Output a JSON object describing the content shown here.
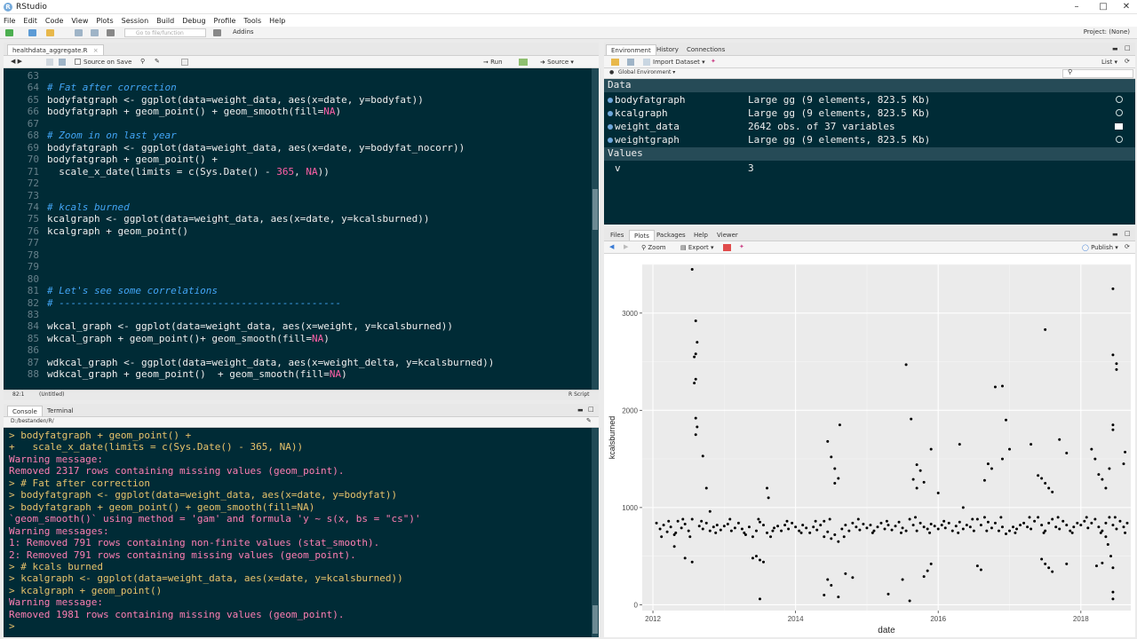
{
  "app": {
    "title": "RStudio"
  },
  "menu": [
    "File",
    "Edit",
    "Code",
    "View",
    "Plots",
    "Session",
    "Build",
    "Debug",
    "Profile",
    "Tools",
    "Help"
  ],
  "toolbar": {
    "goto_placeholder": "Go to file/function",
    "addins": "Addins",
    "project": "Project: (None)"
  },
  "editor": {
    "tab": "healthdata_aggregate.R",
    "source_on_save": "Source on Save",
    "run": "Run",
    "source": "Source",
    "status_left": "82:1",
    "status_scope": "(Untitled)",
    "status_right": "R Script",
    "lines": [
      {
        "n": "63",
        "t": ""
      },
      {
        "n": "64",
        "t": "# Fat after correction"
      },
      {
        "n": "65",
        "t": "bodyfatgraph <- ggplot(data=weight_data, aes(x=date, y=bodyfat))"
      },
      {
        "n": "66",
        "t": "bodyfatgraph + geom_point() + geom_smooth(fill=NA)"
      },
      {
        "n": "67",
        "t": ""
      },
      {
        "n": "68",
        "t": "# Zoom in on last year"
      },
      {
        "n": "69",
        "t": "bodyfatgraph <- ggplot(data=weight_data, aes(x=date, y=bodyfat_nocorr))"
      },
      {
        "n": "70",
        "t": "bodyfatgraph + geom_point() +"
      },
      {
        "n": "71",
        "t": "  scale_x_date(limits = c(Sys.Date() - 365, NA))"
      },
      {
        "n": "72",
        "t": ""
      },
      {
        "n": "73",
        "t": ""
      },
      {
        "n": "74",
        "t": "# kcals burned"
      },
      {
        "n": "75",
        "t": "kcalgraph <- ggplot(data=weight_data, aes(x=date, y=kcalsburned))"
      },
      {
        "n": "76",
        "t": "kcalgraph + geom_point()"
      },
      {
        "n": "77",
        "t": ""
      },
      {
        "n": "78",
        "t": ""
      },
      {
        "n": "79",
        "t": ""
      },
      {
        "n": "80",
        "t": ""
      },
      {
        "n": "81",
        "t": "# Let's see some correlations"
      },
      {
        "n": "82",
        "t": "# ------------------------------------------------"
      },
      {
        "n": "83",
        "t": ""
      },
      {
        "n": "84",
        "t": "wkcal_graph <- ggplot(data=weight_data, aes(x=weight, y=kcalsburned))"
      },
      {
        "n": "85",
        "t": "wkcal_graph + geom_point()+ geom_smooth(fill=NA)"
      },
      {
        "n": "86",
        "t": ""
      },
      {
        "n": "87",
        "t": "wdkcal_graph <- ggplot(data=weight_data, aes(x=weight_delta, y=kcalsburned))"
      },
      {
        "n": "88",
        "t": "wdkcal_graph + geom_point()  + geom_smooth(fill=NA)"
      }
    ]
  },
  "console": {
    "tabs": [
      "Console",
      "Terminal"
    ],
    "path": "D:/bestanden/R/",
    "lines": [
      {
        "c": "cyl",
        "t": "> bodyfatgraph + geom_point() +"
      },
      {
        "c": "cyl",
        "t": "+   scale_x_date(limits = c(Sys.Date() - 365, NA))"
      },
      {
        "c": "cr",
        "t": "Warning message:"
      },
      {
        "c": "cr",
        "t": "Removed 2317 rows containing missing values (geom_point)."
      },
      {
        "c": "cyl",
        "t": "> # Fat after correction"
      },
      {
        "c": "cyl",
        "t": "> bodyfatgraph <- ggplot(data=weight_data, aes(x=date, y=bodyfat))"
      },
      {
        "c": "cyl",
        "t": "> bodyfatgraph + geom_point() + geom_smooth(fill=NA)"
      },
      {
        "c": "cr",
        "t": "`geom_smooth()` using method = 'gam' and formula 'y ~ s(x, bs = \"cs\")'"
      },
      {
        "c": "cr",
        "t": "Warning messages:"
      },
      {
        "c": "cr",
        "t": "1: Removed 791 rows containing non-finite values (stat_smooth)."
      },
      {
        "c": "cr",
        "t": "2: Removed 791 rows containing missing values (geom_point)."
      },
      {
        "c": "cyl",
        "t": "> # kcals burned"
      },
      {
        "c": "cyl",
        "t": "> kcalgraph <- ggplot(data=weight_data, aes(x=date, y=kcalsburned))"
      },
      {
        "c": "cyl",
        "t": "> kcalgraph + geom_point()"
      },
      {
        "c": "cr",
        "t": "Warning message:"
      },
      {
        "c": "cr",
        "t": "Removed 1981 rows containing missing values (geom_point)."
      },
      {
        "c": "cyl",
        "t": ">"
      }
    ]
  },
  "environment": {
    "tabs": [
      "Environment",
      "History",
      "Connections"
    ],
    "import": "Import Dataset",
    "list": "List",
    "scope": "Global Environment",
    "data_header": "Data",
    "values_header": "Values",
    "data": [
      {
        "name": "bodyfatgraph",
        "value": "Large gg (9 elements, 823.5 Kb)"
      },
      {
        "name": "kcalgraph",
        "value": "Large gg (9 elements, 823.5 Kb)"
      },
      {
        "name": "weight_data",
        "value": "2642 obs. of 37 variables"
      },
      {
        "name": "weightgraph",
        "value": "Large gg (9 elements, 823.5 Kb)"
      }
    ],
    "values": [
      {
        "name": "v",
        "value": "3"
      }
    ]
  },
  "files": {
    "tabs": [
      "Files",
      "Plots",
      "Packages",
      "Help",
      "Viewer"
    ],
    "zoom": "Zoom",
    "export": "Export",
    "publish": "Publish"
  },
  "chart_data": {
    "type": "scatter",
    "xlabel": "date",
    "ylabel": "kcalsburned",
    "xticks": [
      "2012",
      "2014",
      "2016",
      "2018"
    ],
    "yticks": [
      "0",
      "1000",
      "2000",
      "3000"
    ],
    "xlim": [
      2011.85,
      2018.7
    ],
    "ylim": [
      -60,
      3500
    ],
    "grid": true,
    "points_note_free": true,
    "points": [
      [
        2012.55,
        3450
      ],
      [
        2012.6,
        2920
      ],
      [
        2012.62,
        2700
      ],
      [
        2012.6,
        2580
      ],
      [
        2012.58,
        2550
      ],
      [
        2012.6,
        2320
      ],
      [
        2012.58,
        2280
      ],
      [
        2012.6,
        1920
      ],
      [
        2012.62,
        1830
      ],
      [
        2012.6,
        1750
      ],
      [
        2012.7,
        1530
      ],
      [
        2012.75,
        1200
      ],
      [
        2012.8,
        960
      ],
      [
        2012.3,
        600
      ],
      [
        2012.45,
        480
      ],
      [
        2012.55,
        440
      ],
      [
        2013.4,
        480
      ],
      [
        2013.5,
        460
      ],
      [
        2013.55,
        440
      ],
      [
        2013.45,
        500
      ],
      [
        2013.6,
        1200
      ],
      [
        2013.62,
        1100
      ],
      [
        2013.5,
        60
      ],
      [
        2014.45,
        1680
      ],
      [
        2014.5,
        1520
      ],
      [
        2014.55,
        1400
      ],
      [
        2014.6,
        1300
      ],
      [
        2014.62,
        1850
      ],
      [
        2014.55,
        1250
      ],
      [
        2014.4,
        700
      ],
      [
        2014.45,
        260
      ],
      [
        2014.5,
        200
      ],
      [
        2014.4,
        100
      ],
      [
        2014.6,
        80
      ],
      [
        2014.7,
        320
      ],
      [
        2014.8,
        280
      ],
      [
        2015.3,
        110
      ],
      [
        2015.5,
        260
      ],
      [
        2015.6,
        40
      ],
      [
        2015.8,
        290
      ],
      [
        2015.85,
        350
      ],
      [
        2015.9,
        420
      ],
      [
        2015.55,
        2470
      ],
      [
        2015.62,
        1910
      ],
      [
        2015.7,
        1440
      ],
      [
        2015.75,
        1380
      ],
      [
        2015.8,
        1260
      ],
      [
        2015.65,
        1290
      ],
      [
        2015.7,
        1200
      ],
      [
        2015.9,
        1600
      ],
      [
        2016.0,
        1150
      ],
      [
        2016.3,
        1650
      ],
      [
        2016.35,
        1000
      ],
      [
        2016.55,
        400
      ],
      [
        2016.6,
        360
      ],
      [
        2016.8,
        2240
      ],
      [
        2016.9,
        2250
      ],
      [
        2016.95,
        1900
      ],
      [
        2016.7,
        1450
      ],
      [
        2016.75,
        1400
      ],
      [
        2016.65,
        1280
      ],
      [
        2016.9,
        1500
      ],
      [
        2017.0,
        1600
      ],
      [
        2017.3,
        1650
      ],
      [
        2017.4,
        1330
      ],
      [
        2017.45,
        1300
      ],
      [
        2017.5,
        1250
      ],
      [
        2017.55,
        1200
      ],
      [
        2017.6,
        1160
      ],
      [
        2017.7,
        1700
      ],
      [
        2017.8,
        1560
      ],
      [
        2017.5,
        2830
      ],
      [
        2017.45,
        470
      ],
      [
        2017.5,
        420
      ],
      [
        2017.55,
        380
      ],
      [
        2017.6,
        340
      ],
      [
        2017.8,
        420
      ],
      [
        2018.15,
        1600
      ],
      [
        2018.2,
        1500
      ],
      [
        2018.25,
        1340
      ],
      [
        2018.3,
        1290
      ],
      [
        2018.35,
        1200
      ],
      [
        2018.4,
        1400
      ],
      [
        2018.45,
        1850
      ],
      [
        2018.45,
        1800
      ],
      [
        2018.45,
        2570
      ],
      [
        2018.5,
        2480
      ],
      [
        2018.5,
        2420
      ],
      [
        2018.45,
        3250
      ],
      [
        2018.6,
        1450
      ],
      [
        2018.62,
        1570
      ],
      [
        2018.35,
        700
      ],
      [
        2018.38,
        620
      ],
      [
        2018.42,
        500
      ],
      [
        2018.45,
        380
      ],
      [
        2018.45,
        130
      ],
      [
        2018.45,
        60
      ],
      [
        2018.3,
        430
      ],
      [
        2018.22,
        400
      ],
      [
        2012.05,
        840
      ],
      [
        2012.1,
        780
      ],
      [
        2012.15,
        820
      ],
      [
        2012.2,
        750
      ],
      [
        2012.25,
        800
      ],
      [
        2012.3,
        720
      ],
      [
        2012.35,
        860
      ],
      [
        2012.4,
        790
      ],
      [
        2012.45,
        830
      ],
      [
        2012.5,
        760
      ],
      [
        2012.55,
        880
      ],
      [
        2012.65,
        810
      ],
      [
        2012.7,
        780
      ],
      [
        2012.75,
        840
      ],
      [
        2012.8,
        760
      ],
      [
        2012.85,
        800
      ],
      [
        2012.9,
        820
      ],
      [
        2012.95,
        770
      ],
      [
        2013.0,
        810
      ],
      [
        2013.05,
        830
      ],
      [
        2013.1,
        760
      ],
      [
        2013.15,
        790
      ],
      [
        2013.2,
        840
      ],
      [
        2013.25,
        780
      ],
      [
        2013.3,
        720
      ],
      [
        2013.35,
        800
      ],
      [
        2013.4,
        700
      ],
      [
        2013.45,
        760
      ],
      [
        2013.5,
        850
      ],
      [
        2013.55,
        820
      ],
      [
        2013.6,
        740
      ],
      [
        2013.65,
        700
      ],
      [
        2013.7,
        790
      ],
      [
        2013.75,
        810
      ],
      [
        2013.8,
        760
      ],
      [
        2013.85,
        820
      ],
      [
        2013.9,
        780
      ],
      [
        2013.95,
        840
      ],
      [
        2014.0,
        800
      ],
      [
        2014.05,
        760
      ],
      [
        2014.1,
        820
      ],
      [
        2014.15,
        790
      ],
      [
        2014.2,
        740
      ],
      [
        2014.25,
        800
      ],
      [
        2014.3,
        770
      ],
      [
        2014.35,
        820
      ],
      [
        2014.4,
        860
      ],
      [
        2014.45,
        750
      ],
      [
        2014.5,
        680
      ],
      [
        2014.55,
        720
      ],
      [
        2014.6,
        650
      ],
      [
        2014.65,
        780
      ],
      [
        2014.7,
        820
      ],
      [
        2014.75,
        760
      ],
      [
        2014.8,
        840
      ],
      [
        2014.85,
        800
      ],
      [
        2014.9,
        770
      ],
      [
        2014.95,
        830
      ],
      [
        2015.0,
        790
      ],
      [
        2015.05,
        820
      ],
      [
        2015.1,
        760
      ],
      [
        2015.15,
        800
      ],
      [
        2015.2,
        840
      ],
      [
        2015.25,
        780
      ],
      [
        2015.3,
        820
      ],
      [
        2015.35,
        770
      ],
      [
        2015.4,
        810
      ],
      [
        2015.45,
        850
      ],
      [
        2015.5,
        790
      ],
      [
        2015.55,
        760
      ],
      [
        2015.6,
        880
      ],
      [
        2015.65,
        820
      ],
      [
        2015.7,
        760
      ],
      [
        2015.75,
        840
      ],
      [
        2015.8,
        800
      ],
      [
        2015.85,
        780
      ],
      [
        2015.9,
        830
      ],
      [
        2015.95,
        810
      ],
      [
        2016.0,
        780
      ],
      [
        2016.05,
        820
      ],
      [
        2016.1,
        790
      ],
      [
        2016.15,
        840
      ],
      [
        2016.2,
        760
      ],
      [
        2016.25,
        810
      ],
      [
        2016.3,
        850
      ],
      [
        2016.35,
        780
      ],
      [
        2016.4,
        820
      ],
      [
        2016.45,
        800
      ],
      [
        2016.5,
        760
      ],
      [
        2016.55,
        880
      ],
      [
        2016.6,
        820
      ],
      [
        2016.65,
        900
      ],
      [
        2016.7,
        850
      ],
      [
        2016.75,
        790
      ],
      [
        2016.8,
        840
      ],
      [
        2016.85,
        760
      ],
      [
        2016.9,
        800
      ],
      [
        2016.95,
        730
      ],
      [
        2017.0,
        760
      ],
      [
        2017.05,
        800
      ],
      [
        2017.1,
        780
      ],
      [
        2017.15,
        820
      ],
      [
        2017.2,
        840
      ],
      [
        2017.25,
        800
      ],
      [
        2017.3,
        780
      ],
      [
        2017.35,
        860
      ],
      [
        2017.4,
        900
      ],
      [
        2017.45,
        820
      ],
      [
        2017.5,
        760
      ],
      [
        2017.55,
        840
      ],
      [
        2017.6,
        880
      ],
      [
        2017.65,
        800
      ],
      [
        2017.7,
        780
      ],
      [
        2017.75,
        860
      ],
      [
        2017.8,
        820
      ],
      [
        2017.85,
        760
      ],
      [
        2017.9,
        800
      ],
      [
        2017.95,
        840
      ],
      [
        2018.0,
        820
      ],
      [
        2018.05,
        860
      ],
      [
        2018.1,
        790
      ],
      [
        2018.15,
        840
      ],
      [
        2018.2,
        880
      ],
      [
        2018.25,
        800
      ],
      [
        2018.3,
        760
      ],
      [
        2018.35,
        840
      ],
      [
        2018.4,
        900
      ],
      [
        2018.45,
        820
      ],
      [
        2018.5,
        780
      ],
      [
        2018.55,
        860
      ],
      [
        2018.6,
        800
      ],
      [
        2018.65,
        840
      ],
      [
        2012.12,
        700
      ],
      [
        2012.22,
        860
      ],
      [
        2012.32,
        740
      ],
      [
        2012.42,
        880
      ],
      [
        2012.52,
        700
      ],
      [
        2012.68,
        860
      ],
      [
        2012.88,
        740
      ],
      [
        2013.08,
        880
      ],
      [
        2013.28,
        740
      ],
      [
        2013.48,
        880
      ],
      [
        2013.68,
        760
      ],
      [
        2013.88,
        860
      ],
      [
        2014.08,
        740
      ],
      [
        2014.28,
        860
      ],
      [
        2014.48,
        880
      ],
      [
        2014.68,
        700
      ],
      [
        2014.88,
        880
      ],
      [
        2015.08,
        740
      ],
      [
        2015.28,
        860
      ],
      [
        2015.48,
        740
      ],
      [
        2015.68,
        900
      ],
      [
        2015.88,
        740
      ],
      [
        2016.08,
        860
      ],
      [
        2016.28,
        740
      ],
      [
        2016.48,
        880
      ],
      [
        2016.68,
        760
      ],
      [
        2016.88,
        900
      ],
      [
        2017.08,
        740
      ],
      [
        2017.28,
        900
      ],
      [
        2017.48,
        740
      ],
      [
        2017.68,
        900
      ],
      [
        2017.88,
        740
      ],
      [
        2018.08,
        900
      ],
      [
        2018.28,
        740
      ],
      [
        2018.48,
        900
      ],
      [
        2018.62,
        740
      ]
    ]
  }
}
